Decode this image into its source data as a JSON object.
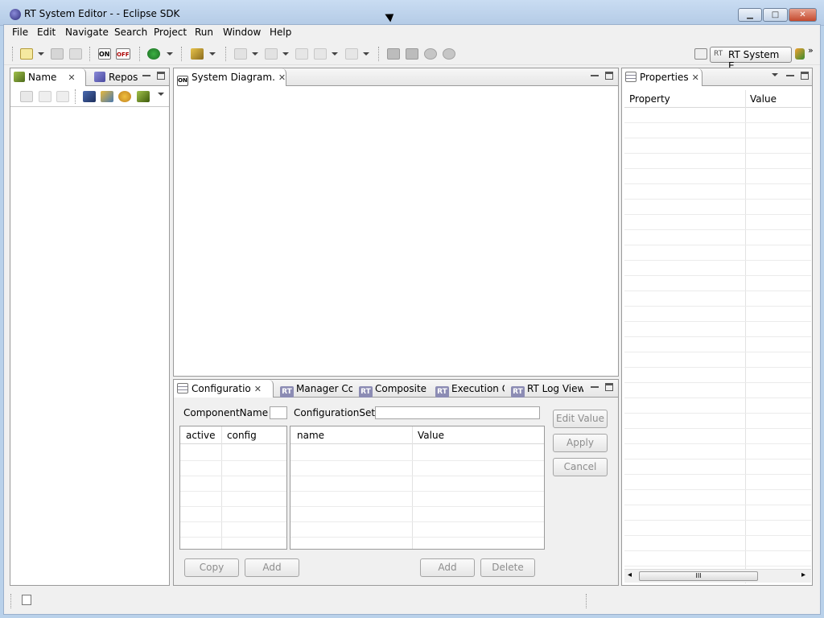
{
  "window": {
    "title": "RT System Editor -  - Eclipse SDK",
    "min": "▁",
    "max": "□",
    "close": "✕"
  },
  "menubar": {
    "items": [
      "File",
      "Edit",
      "Navigate",
      "Search",
      "Project",
      "Run",
      "Window",
      "Help"
    ]
  },
  "toolbar": {
    "on_label": "ON",
    "off_label": "OFF",
    "perspective_label": "RT System E...",
    "perspective_prefix": "RT",
    "overflow": "»"
  },
  "left_panel": {
    "tabs": [
      {
        "label": "Name",
        "close": "✕"
      },
      {
        "label": "Repos"
      }
    ]
  },
  "editor": {
    "tab_label": "System Diagram.",
    "tab_close": "✕",
    "tab_icon_text": "ON"
  },
  "properties": {
    "tab_label": "Properties",
    "tab_close": "✕",
    "columns": [
      "Property",
      "Value"
    ]
  },
  "bottom_panel": {
    "tabs": [
      {
        "label": "Configuratio",
        "close": "✕"
      },
      {
        "label": "Manager Co",
        "icon": "RT"
      },
      {
        "label": "Composite",
        "icon": "RT"
      },
      {
        "label": "Execution C",
        "icon": "RT"
      },
      {
        "label": "RT Log View",
        "icon": "RT"
      }
    ],
    "component_name_label": "ComponentName :",
    "configuration_set_label": "ConfigurationSet :",
    "left_table_columns": [
      "active",
      "config"
    ],
    "right_table_columns": [
      "name",
      "Value"
    ],
    "buttons": {
      "edit_value": "Edit Value",
      "apply": "Apply",
      "cancel": "Cancel",
      "copy": "Copy",
      "add_left": "Add",
      "add_right": "Add",
      "delete": "Delete"
    }
  },
  "scrollbar": {
    "grip": "III",
    "left_arrow": "◂",
    "right_arrow": "▸"
  }
}
